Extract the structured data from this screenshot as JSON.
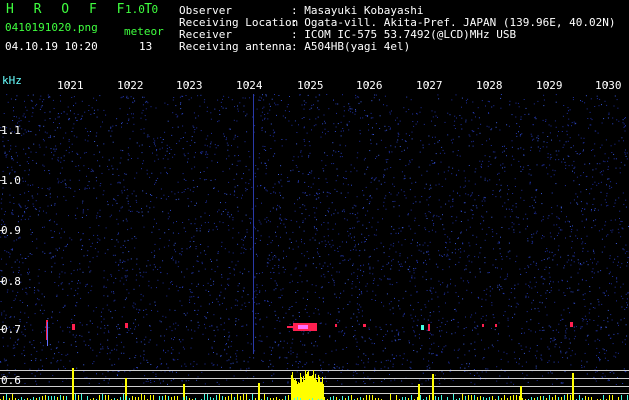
{
  "app": {
    "name": "H R O F F T",
    "version": "1.0.0"
  },
  "file": {
    "name": "0410191020.png",
    "datetime": "04.10.19 10:20"
  },
  "meteor": {
    "label": "meteor",
    "count": "13"
  },
  "info": {
    "observer_label": "Observer",
    "observer_value": ": Masayuki Kobayashi",
    "location_label": "Receiving Location",
    "location_value": ": Ogata-vill. Akita-Pref. JAPAN (139.96E, 40.02N)",
    "receiver_label": "Receiver",
    "receiver_value": ": ICOM IC-575 53.7492(@LCD)MHz USB",
    "antenna_label": "Receiving antenna",
    "antenna_value": ": A504HB(yagi 4el)"
  },
  "axes": {
    "x_unit": "kHz",
    "x_ticks": [
      "1021",
      "1022",
      "1023",
      "1024",
      "1025",
      "1026",
      "1027",
      "1028",
      "1029",
      "1030"
    ],
    "y_ticks": [
      "1.1",
      "1.0",
      "0.9",
      "0.8",
      "0.7",
      "0.6"
    ]
  },
  "colors": {
    "background": "#000000",
    "noise": "#1a2a9a",
    "signal": "#ff2050",
    "histogram": "#ffff00",
    "grid": "#cfcfcf"
  }
}
